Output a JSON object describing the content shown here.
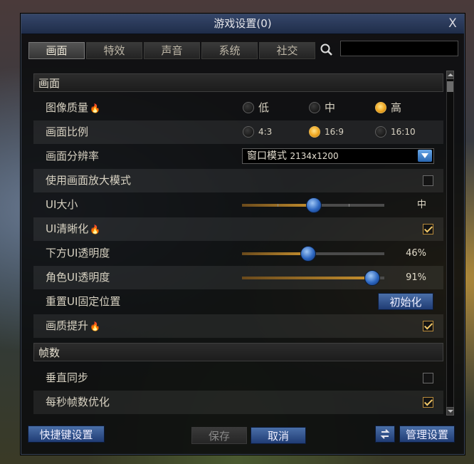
{
  "window": {
    "title": "游戏设置(0)",
    "close_label": "X"
  },
  "tabs": [
    {
      "label": "画面",
      "active": true
    },
    {
      "label": "特效",
      "active": false
    },
    {
      "label": "声音",
      "active": false
    },
    {
      "label": "系统",
      "active": false
    },
    {
      "label": "社交",
      "active": false
    }
  ],
  "search": {
    "value": "",
    "placeholder": ""
  },
  "sections": {
    "display": "画面",
    "framerate": "帧数"
  },
  "settings": {
    "image_quality": {
      "label": "图像质量",
      "options": [
        "低",
        "中",
        "高"
      ],
      "selected": "高"
    },
    "aspect_ratio": {
      "label": "画面比例",
      "options": [
        "4:3",
        "16:9",
        "16:10"
      ],
      "selected": "16:9"
    },
    "resolution": {
      "label": "画面分辨率",
      "mode": "窗口模式",
      "value": "2134x1200"
    },
    "zoom_mode": {
      "label": "使用画面放大模式",
      "checked": false
    },
    "ui_size": {
      "label": "UI大小",
      "value_text": "中",
      "level": 0.5
    },
    "ui_sharpen": {
      "label": "UI清晰化",
      "checked": true
    },
    "bottom_ui_opacity": {
      "label": "下方UI透明度",
      "value_text": "46%",
      "value": 46
    },
    "char_ui_opacity": {
      "label": "角色UI透明度",
      "value_text": "91%",
      "value": 91
    },
    "reset_ui": {
      "label": "重置UI固定位置",
      "button": "初始化"
    },
    "quality_boost": {
      "label": "画质提升",
      "checked": true
    },
    "vsync": {
      "label": "垂直同步",
      "checked": false
    },
    "fps_optimize": {
      "label": "每秒帧数优化",
      "checked": true
    }
  },
  "footer": {
    "shortcut_label": "快捷键设置",
    "save_label": "保存",
    "cancel_label": "取消",
    "manage_label": "管理设置"
  },
  "colors": {
    "accent_gold": "#f0a823",
    "button_blue": "#2f5590",
    "title_blue": "#2b3b5e"
  }
}
